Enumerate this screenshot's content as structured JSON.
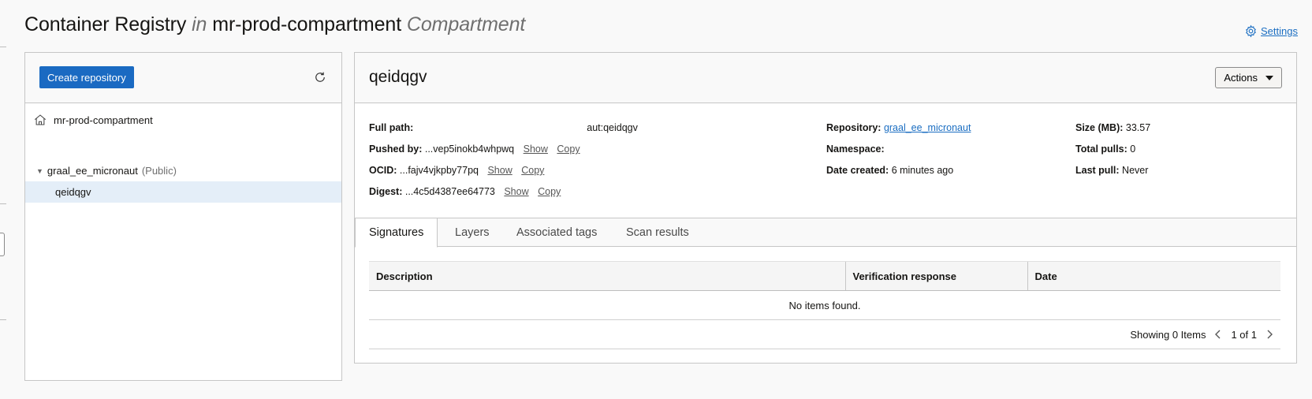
{
  "page": {
    "title_main": "Container Registry",
    "title_in": "in",
    "title_compartment": "mr-prod-compartment",
    "title_suffix": "Compartment",
    "settings_label": "Settings"
  },
  "tree": {
    "create_label": "Create repository",
    "root_label": "mr-prod-compartment",
    "repo_name": "graal_ee_micronaut",
    "repo_visibility": "(Public)",
    "image_name": "qeidqgv"
  },
  "detail": {
    "title": "qeidqgv",
    "actions_label": "Actions",
    "full_path_label": "Full path:",
    "full_path_value": "aut:qeidqgv",
    "pushed_by_label": "Pushed by:",
    "pushed_by_value": "...vep5inokb4whpwq",
    "ocid_label": "OCID:",
    "ocid_value": "...fajv4vjkpby77pq",
    "digest_label": "Digest:",
    "digest_value": "...4c5d4387ee64773",
    "show_label": "Show",
    "copy_label": "Copy",
    "repository_label": "Repository:",
    "repository_value": "graal_ee_micronaut",
    "namespace_label": "Namespace:",
    "date_created_label": "Date created:",
    "date_created_value": "6 minutes ago",
    "size_label": "Size (MB):",
    "size_value": "33.57",
    "total_pulls_label": "Total pulls:",
    "total_pulls_value": "0",
    "last_pull_label": "Last pull:",
    "last_pull_value": "Never"
  },
  "tabs": [
    "Signatures",
    "Layers",
    "Associated tags",
    "Scan results"
  ],
  "table": {
    "columns": [
      "Description",
      "Verification response",
      "Date"
    ],
    "empty_text": "No items found.",
    "showing_text": "Showing 0 Items",
    "page_text": "1 of 1"
  },
  "colors": {
    "primary": "#1a6ac2",
    "link": "#1b6ec2",
    "selected_row": "#e4eef8"
  }
}
